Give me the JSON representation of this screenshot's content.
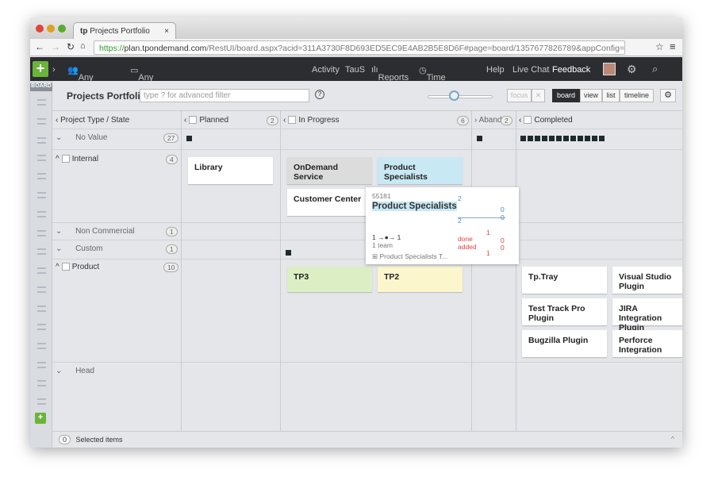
{
  "browser": {
    "tab_title": "Projects Portfolio",
    "url_https": "https://",
    "url_host": "plan.tpondemand.com",
    "url_rest": "/RestUI/board.aspx?acid=311A3730F8D693ED5EC9E4AB2B5E8D6F#page=board/1357677826789&appConfig=eyJhY2l..."
  },
  "nav": {
    "team": "Any Team",
    "project": "Any Project",
    "items": [
      "Activity",
      "TauS",
      "Reports",
      "Time Sheet",
      "Help",
      "Live Chat",
      "Feedback"
    ]
  },
  "sidebar": {
    "board_label": "BOARD"
  },
  "toolbar": {
    "title": "Projects Portfolio",
    "filter_placeholder": "type ? for advanced filter",
    "focus": "focus",
    "views": [
      "board",
      "view",
      "list",
      "timeline"
    ],
    "active_view": "board",
    "zoom_level": 0.5
  },
  "columns": [
    {
      "label": "Project Type / State"
    },
    {
      "label": "Planned",
      "count": "2"
    },
    {
      "label": "In Progress",
      "count": "6"
    },
    {
      "label": "Aband",
      "count": "2"
    },
    {
      "label": "Completed"
    }
  ],
  "rows": [
    {
      "label": "No Value",
      "count": "27"
    },
    {
      "label": "Internal",
      "count": "4"
    },
    {
      "label": "Non Commercial",
      "count": "1"
    },
    {
      "label": "Custom",
      "count": "1"
    },
    {
      "label": "Product",
      "count": "10"
    },
    {
      "label": "Head"
    }
  ],
  "cards": {
    "library": "Library",
    "ondemand": "OnDemand Service",
    "specialists": "Product Specialists",
    "customer_center": "Customer Center",
    "tp3": "TP3",
    "tp2": "TP2",
    "tptray": "Tp.Tray",
    "vs": "Visual Studio Plugin",
    "ttp": "Test Track Pro Plugin",
    "jira": "JIRA Integration Plugin",
    "bugzilla": "Bugzilla Plugin",
    "perforce": "Perforce Integration"
  },
  "popup": {
    "id": "55181",
    "title": "Product Specialists",
    "flow": "1 →●→ 1",
    "teams": "1 team",
    "link": "Product Specialists T...",
    "done": "done",
    "added": "added",
    "top_nums": [
      "2",
      "2",
      "0",
      "0"
    ],
    "bottom_nums": [
      "1",
      "1",
      "0",
      "0"
    ]
  },
  "footer": {
    "count": "0",
    "label": "Selected items"
  },
  "colors": {
    "nav_bg": "#2b2d30",
    "accent_green": "#6ab43b",
    "card_gray": "#dcdcdc",
    "card_blue": "#c8e8f4",
    "card_green": "#dcefc4",
    "card_yellow": "#fbf6cc"
  }
}
